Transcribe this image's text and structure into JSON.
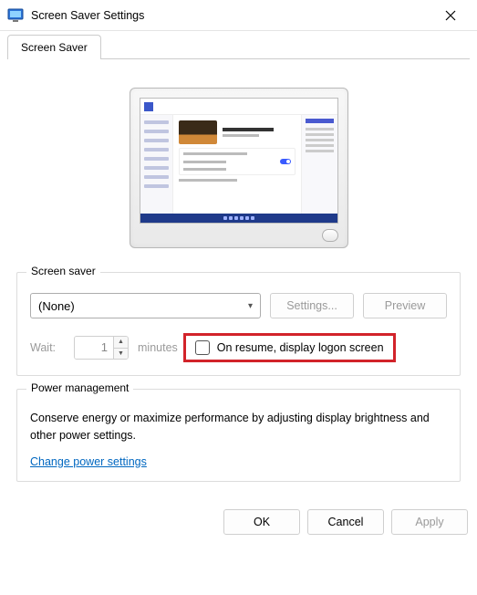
{
  "titlebar": {
    "title": "Screen Saver Settings"
  },
  "tab": {
    "label": "Screen Saver"
  },
  "screensaver_group": {
    "legend": "Screen saver",
    "dropdown_value": "(None)",
    "settings_button": "Settings...",
    "preview_button": "Preview",
    "wait_label": "Wait:",
    "wait_value": "1",
    "minutes_label": "minutes",
    "resume_label": "On resume, display logon screen"
  },
  "power_group": {
    "legend": "Power management",
    "description": "Conserve energy or maximize performance by adjusting display brightness and other power settings.",
    "link": "Change power settings"
  },
  "footer": {
    "ok": "OK",
    "cancel": "Cancel",
    "apply": "Apply"
  }
}
